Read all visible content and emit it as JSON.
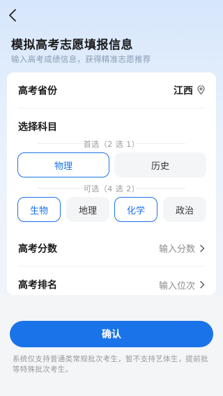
{
  "header": {
    "back_icon": "chevron-left-icon",
    "title": "模拟高考志愿填报信息",
    "subtitle": "输入高考成绩信息，获得精准志愿推荐"
  },
  "form": {
    "province": {
      "label": "高考省份",
      "value": "江西",
      "icon": "location-pin-icon"
    },
    "subjects": {
      "label": "选择科目",
      "primary_hint": "首选（2 选 1）",
      "primary_options": [
        {
          "label": "物理",
          "selected": true
        },
        {
          "label": "历史",
          "selected": false
        }
      ],
      "secondary_hint": "可选（4 选 2）",
      "secondary_options": [
        {
          "label": "生物",
          "selected": true
        },
        {
          "label": "地理",
          "selected": false
        },
        {
          "label": "化学",
          "selected": true
        },
        {
          "label": "政治",
          "selected": false
        }
      ]
    },
    "score": {
      "label": "高考分数",
      "placeholder": "输入分数",
      "icon": "chevron-right-icon"
    },
    "rank": {
      "label": "高考排名",
      "placeholder": "输入位次",
      "icon": "chevron-right-icon"
    }
  },
  "footer": {
    "confirm_label": "确认",
    "notice": "系统仅支持普通类常规批次考生，暂不支持艺体生，提前批等特殊批次考生。"
  },
  "colors": {
    "accent": "#1a73e8",
    "chip_bg": "#f4f5f7"
  }
}
